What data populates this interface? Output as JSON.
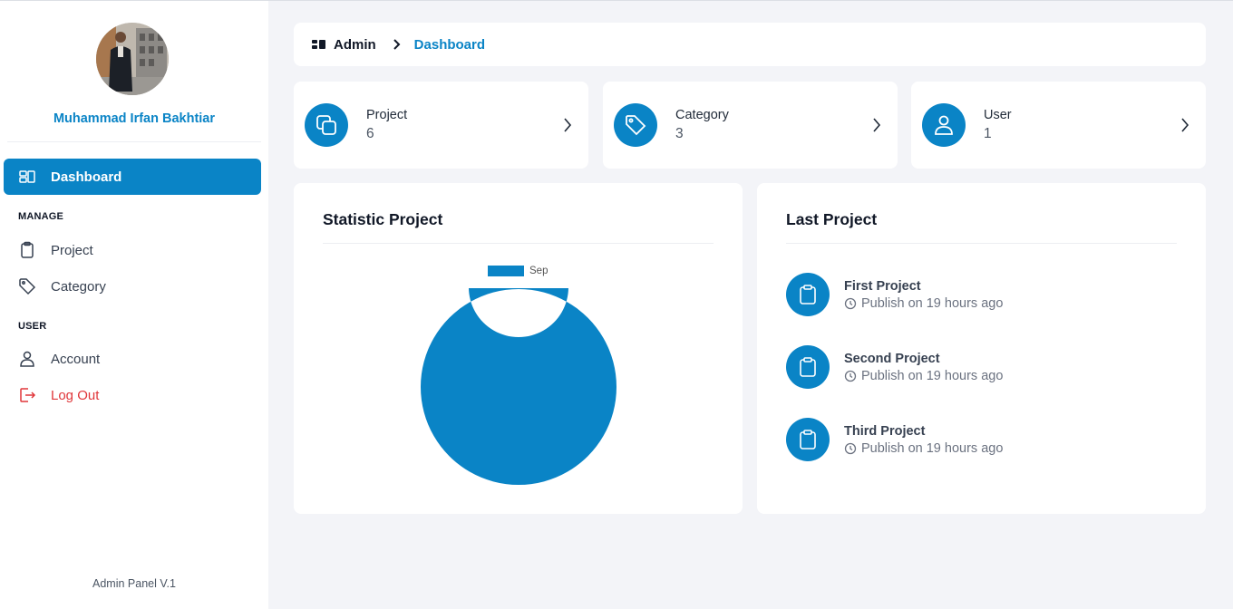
{
  "sidebar": {
    "user_name": "Muhammad Irfan Bakhtiar",
    "items": [
      {
        "label": "Dashboard",
        "icon": "dashboard-icon"
      },
      {
        "label": "Project",
        "icon": "clipboard-icon"
      },
      {
        "label": "Category",
        "icon": "tag-icon"
      },
      {
        "label": "Account",
        "icon": "user-icon"
      },
      {
        "label": "Log Out",
        "icon": "logout-icon"
      }
    ],
    "sections": {
      "manage": "MANAGE",
      "user": "USER"
    },
    "footer": "Admin Panel V.1"
  },
  "breadcrumb": {
    "home": "Admin",
    "current": "Dashboard"
  },
  "stats": [
    {
      "label": "Project",
      "value": "6",
      "icon": "copy-icon"
    },
    {
      "label": "Category",
      "value": "3",
      "icon": "tag-icon"
    },
    {
      "label": "User",
      "value": "1",
      "icon": "user-icon"
    }
  ],
  "statistic": {
    "title": "Statistic Project"
  },
  "chart_data": {
    "type": "pie",
    "variant": "donut",
    "categories": [
      "Sep"
    ],
    "values": [
      6
    ],
    "legend": "top",
    "colors": [
      "#0a84c6"
    ]
  },
  "last_project": {
    "title": "Last Project",
    "items": [
      {
        "name": "First Project",
        "meta": "Publish on 19 hours ago"
      },
      {
        "name": "Second Project",
        "meta": "Publish on 19 hours ago"
      },
      {
        "name": "Third Project",
        "meta": "Publish on 19 hours ago"
      }
    ]
  },
  "colors": {
    "accent": "#0a84c6",
    "danger": "#e0363a",
    "background": "#f3f4f8"
  }
}
